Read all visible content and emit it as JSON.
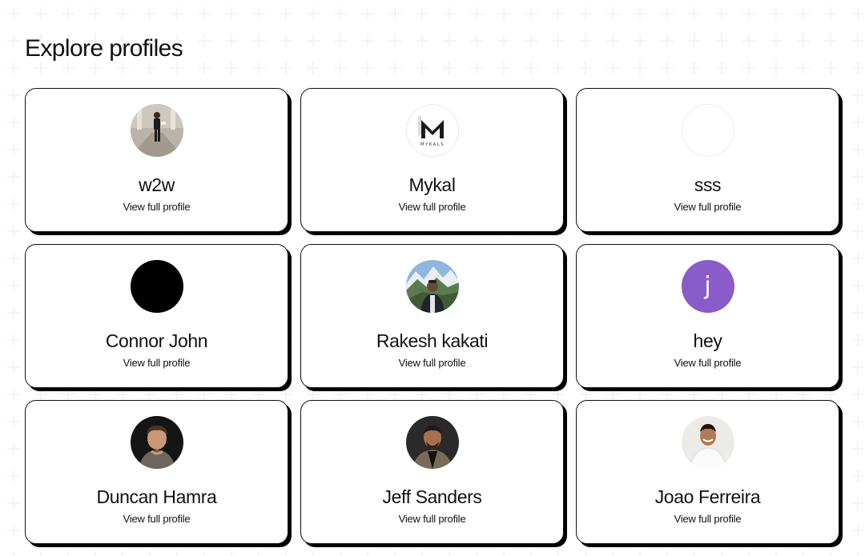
{
  "page": {
    "title": "Explore profiles"
  },
  "profiles": [
    {
      "name": "w2w",
      "link_label": "View full profile",
      "avatar": "photo-person-standing-icon"
    },
    {
      "name": "Mykal",
      "link_label": "View full profile",
      "avatar": "mykals-logo-icon",
      "logo_text": "MYKALS"
    },
    {
      "name": "sss",
      "link_label": "View full profile",
      "avatar": "empty-avatar-icon"
    },
    {
      "name": "Connor John",
      "link_label": "View full profile",
      "avatar": "black-avatar-icon"
    },
    {
      "name": "Rakesh kakati",
      "link_label": "View full profile",
      "avatar": "photo-mountains-person-icon"
    },
    {
      "name": "hey",
      "link_label": "View full profile",
      "avatar": "letter-avatar-icon",
      "initial": "j",
      "avatar_color": "#8a5cc9"
    },
    {
      "name": "Duncan Hamra",
      "link_label": "View full profile",
      "avatar": "photo-person-dark-icon"
    },
    {
      "name": "Jeff Sanders",
      "link_label": "View full profile",
      "avatar": "photo-person-suit-icon"
    },
    {
      "name": "Joao Ferreira",
      "link_label": "View full profile",
      "avatar": "photo-person-smiling-icon"
    }
  ]
}
